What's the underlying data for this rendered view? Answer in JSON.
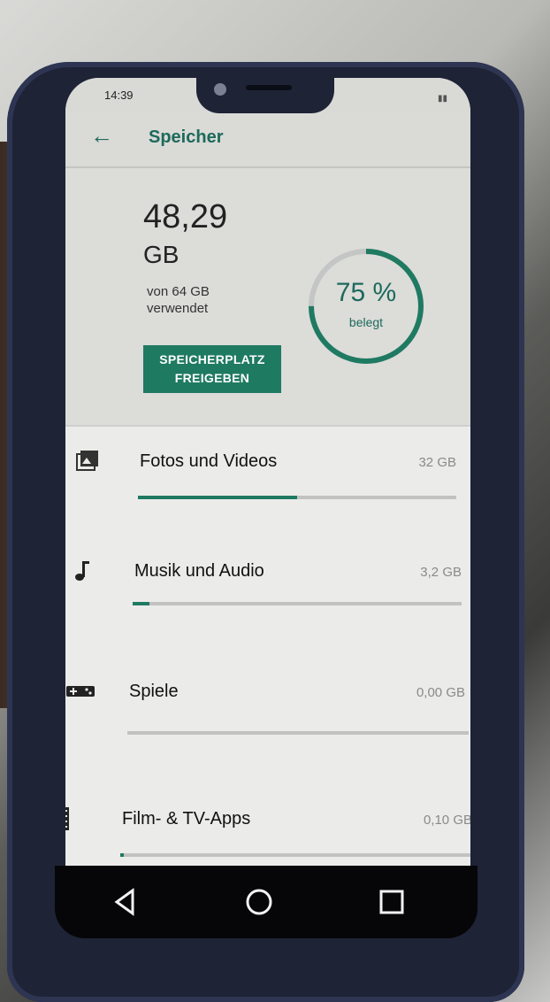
{
  "status_bar": {
    "time": "14:39"
  },
  "app_bar": {
    "title": "Speicher"
  },
  "summary": {
    "used_amount": "48,29",
    "used_unit": "GB",
    "used_description": "von 64 GB verwendet",
    "percent_text": "75 %",
    "percent_label": "belegt",
    "percent_value": 75,
    "free_button_label": "SPEICHERPLATZ FREIGEBEN"
  },
  "categories": [
    {
      "label": "Fotos und Videos",
      "size": "32 GB",
      "fill_fraction": 0.5,
      "icon": "photo-icon"
    },
    {
      "label": "Musik und Audio",
      "size": "3,2 GB",
      "fill_fraction": 0.05,
      "icon": "music-note-icon"
    },
    {
      "label": "Spiele",
      "size": "0,00 GB",
      "fill_fraction": 0.0,
      "icon": "gamepad-icon"
    },
    {
      "label": "Film- & TV-Apps",
      "size": "0,10 GB",
      "fill_fraction": 0.01,
      "icon": "film-icon"
    }
  ],
  "colors": {
    "accent": "#1f7a62"
  }
}
